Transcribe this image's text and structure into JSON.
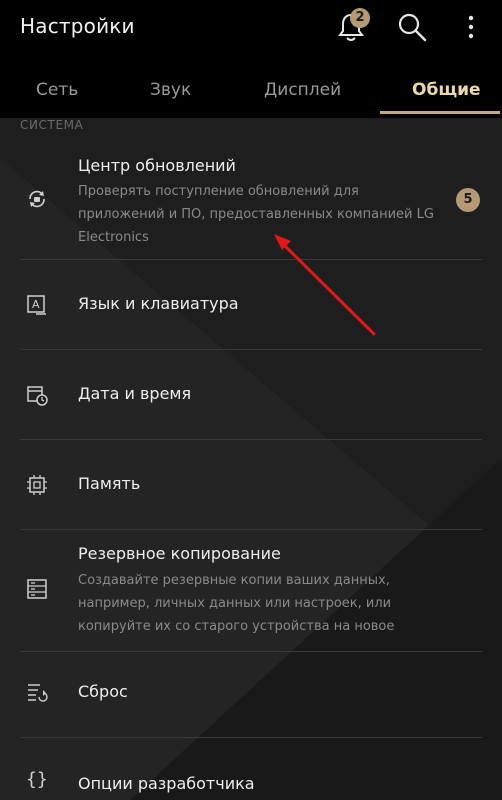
{
  "appbar": {
    "title": "Настройки",
    "notifications_count": "2",
    "icons": [
      "bell-icon",
      "search-icon",
      "more-vert-icon"
    ]
  },
  "tabs": [
    {
      "label": "Сеть",
      "active": false
    },
    {
      "label": "Звук",
      "active": false
    },
    {
      "label": "Дисплей",
      "active": false
    },
    {
      "label": "Общие",
      "active": true
    }
  ],
  "section": {
    "label": "СИСТЕМА"
  },
  "items": [
    {
      "icon": "update-center-icon",
      "title": "Центр обновлений",
      "description": "Проверять поступление обновлений для приложений и ПО, предоставленных компанией LG Electronics",
      "count": "5"
    },
    {
      "icon": "language-keyboard-icon",
      "title": "Язык и клавиатура"
    },
    {
      "icon": "date-time-icon",
      "title": "Дата и время"
    },
    {
      "icon": "memory-chip-icon",
      "title": "Память"
    },
    {
      "icon": "backup-icon",
      "title": "Резервное копирование",
      "description": "Создавайте резервные копии ваших данных, например, личных данных или настроек, или копируйте их со старого устройства на новое"
    },
    {
      "icon": "reset-icon",
      "title": "Сброс"
    },
    {
      "icon": "developer-options-icon",
      "title": "Опции разработчика"
    }
  ],
  "colors": {
    "accent": "#c7a97d",
    "badge": "#b59a76",
    "annotation_arrow": "#e01818",
    "background": "#1e1e1e"
  }
}
